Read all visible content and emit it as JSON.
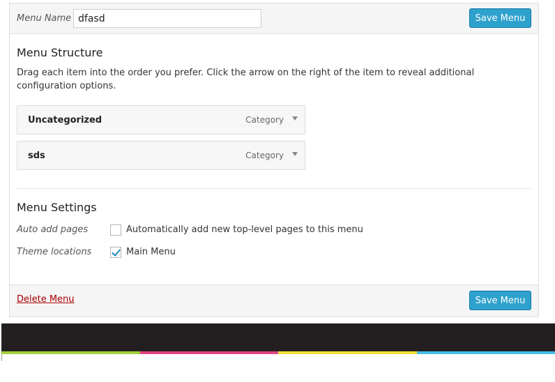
{
  "header": {
    "name_label": "Menu Name",
    "name_value": "dfasd",
    "save_label": "Save Menu"
  },
  "structure": {
    "title": "Menu Structure",
    "description": "Drag each item into the order you prefer. Click the arrow on the right of the item to reveal additional configuration options.",
    "items": [
      {
        "title": "Uncategorized",
        "type": "Category"
      },
      {
        "title": "sds",
        "type": "Category"
      }
    ]
  },
  "settings": {
    "title": "Menu Settings",
    "auto_add": {
      "label": "Auto add pages",
      "option": "Automatically add new top-level pages to this menu",
      "checked": false
    },
    "theme_locations": {
      "label": "Theme locations",
      "option": "Main Menu",
      "checked": true
    }
  },
  "footer": {
    "delete_label": "Delete Menu",
    "save_label": "Save Menu"
  },
  "colors": {
    "accent": "#2ea2cc",
    "stripe": [
      "#a4d13b",
      "#e0427f",
      "#f0e13c",
      "#43bde8"
    ],
    "dark_bar": "#231f20"
  }
}
